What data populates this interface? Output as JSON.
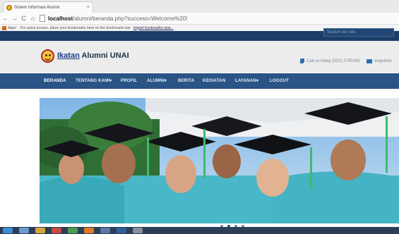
{
  "browser": {
    "tab_title": "Sistem Informasi Alumni",
    "tab_close": "×",
    "url_host": "localhost",
    "url_path": "/alumni/beranda.php?success=Welcome%20!",
    "bookmarks_apps": "Apps",
    "bookmarks_hint": "For quick access, place your bookmarks here on the bookmarks bar.",
    "bookmarks_import": "Import bookmarks now..."
  },
  "site": {
    "search_placeholder": "Search our site",
    "name_prefix": "Ikatan",
    "name_rest": " Alumni UNAI",
    "phone_text": "Call us today (022) 2700163",
    "email_text": "enquiries"
  },
  "nav": {
    "items": [
      "BERANDA",
      "TENTANG KAMI",
      "PROFIL",
      "ALUMNI",
      "BERITA",
      "KEGIATAN",
      "LAYANAN",
      "LOGOUT"
    ]
  },
  "colors": {
    "nav_bg": "#2b5486",
    "top_band": "#1c3e68",
    "header_bg": "#ececec",
    "accent": "#2e6fb5"
  }
}
